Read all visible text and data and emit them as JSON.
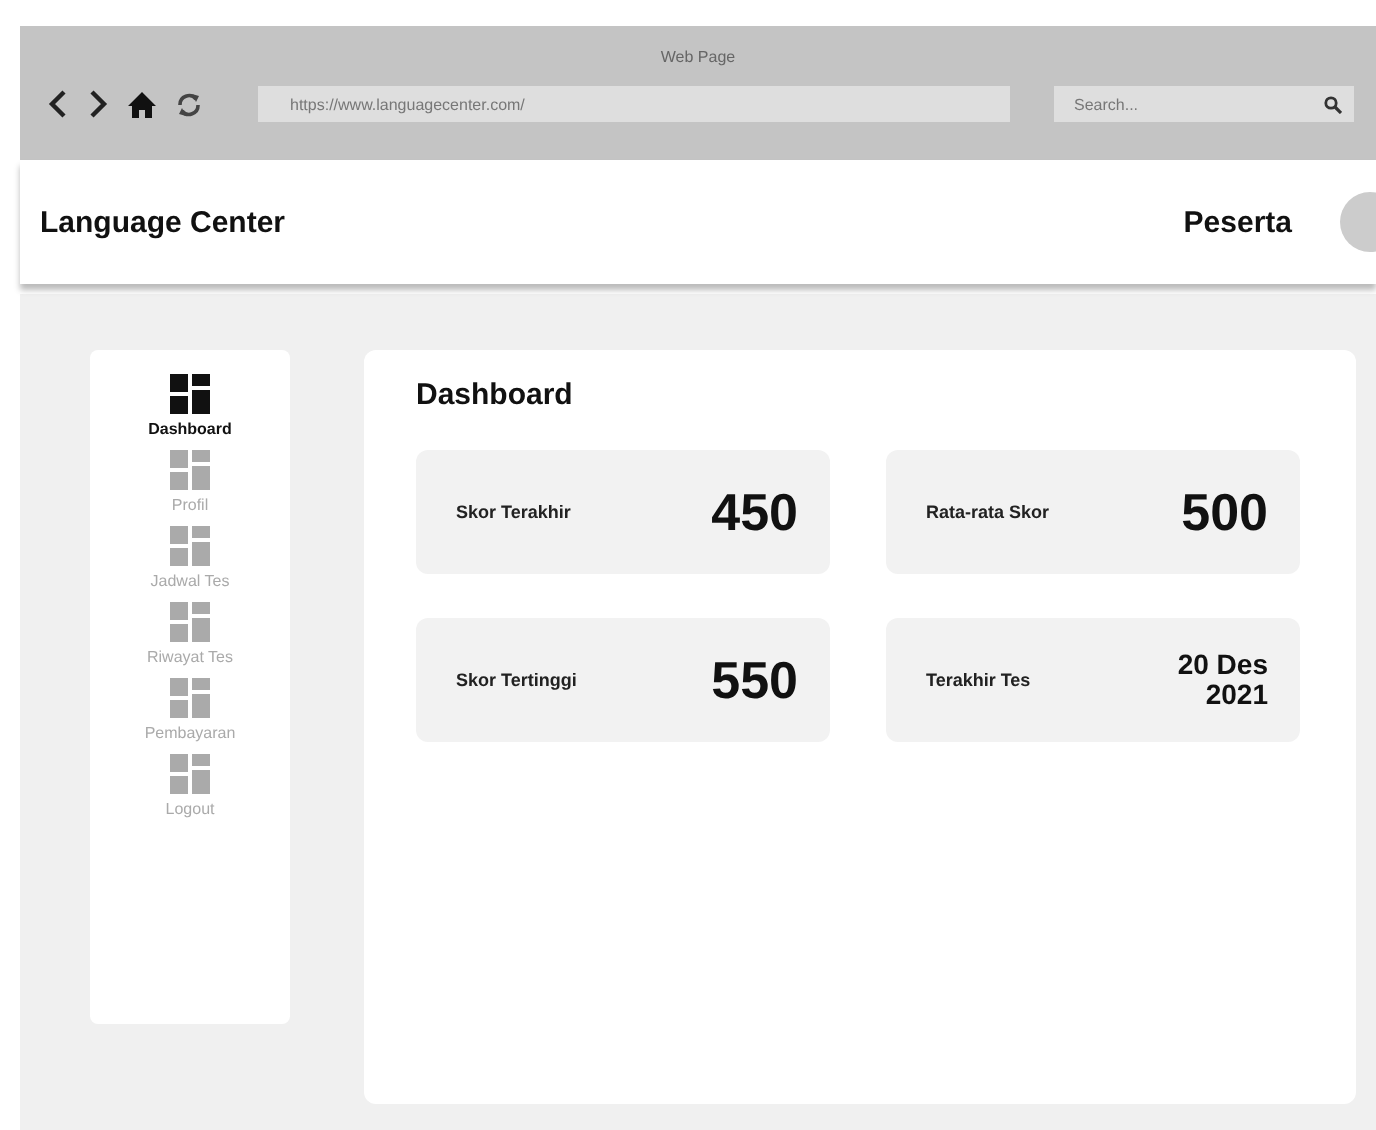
{
  "window": {
    "title": "Web Page"
  },
  "browser": {
    "url": "https://www.languagecenter.com/",
    "search_placeholder": "Search..."
  },
  "header": {
    "brand": "Language Center",
    "user": "Peserta"
  },
  "sidebar": {
    "items": [
      {
        "label": "Dashboard",
        "selected": true
      },
      {
        "label": "Profil",
        "selected": false
      },
      {
        "label": "Jadwal Tes",
        "selected": false
      },
      {
        "label": "Riwayat Tes",
        "selected": false
      },
      {
        "label": "Pembayaran",
        "selected": false
      },
      {
        "label": "Logout",
        "selected": false
      }
    ]
  },
  "main": {
    "title": "Dashboard",
    "stats": [
      {
        "label": "Skor Terakhir",
        "value": "450",
        "kind": "number"
      },
      {
        "label": "Rata-rata Skor",
        "value": "500",
        "kind": "number"
      },
      {
        "label": "Skor Tertinggi",
        "value": "550",
        "kind": "number"
      },
      {
        "label": "Terakhir Tes",
        "value": "20 Des 2021",
        "kind": "date"
      }
    ]
  }
}
